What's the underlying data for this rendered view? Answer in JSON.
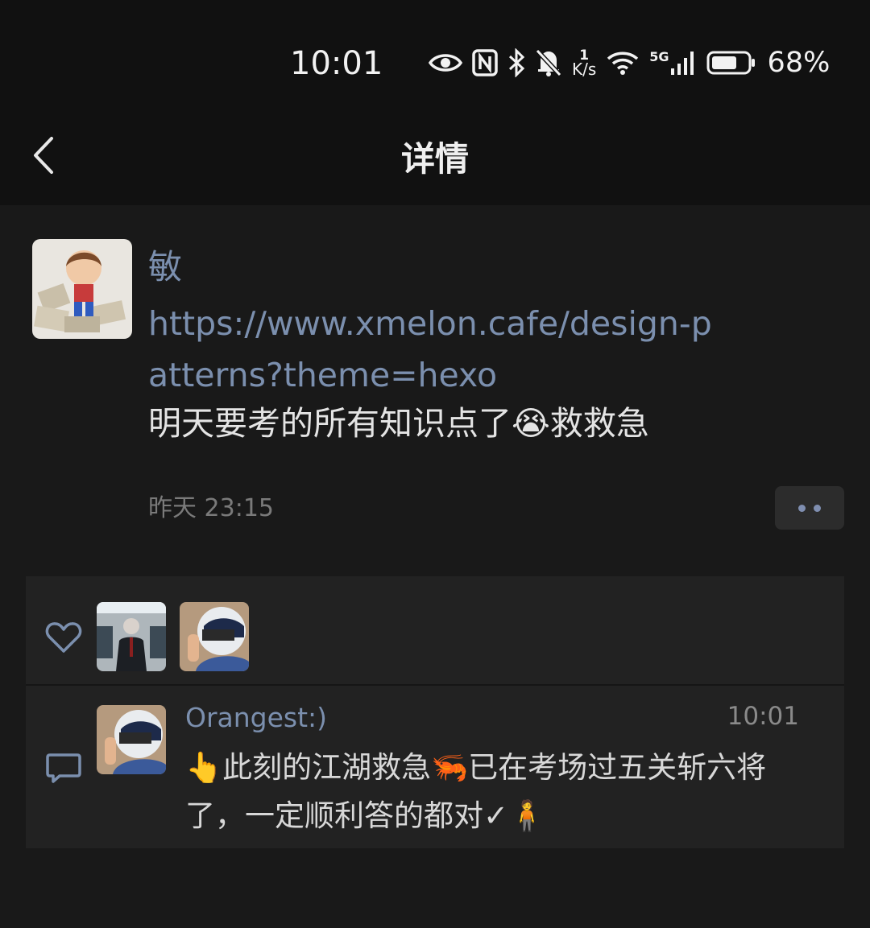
{
  "status_bar": {
    "time": "10:01",
    "speed_value": "1",
    "speed_unit": "K/s",
    "network": "5G",
    "battery_percent": "68%",
    "icons": [
      "eye-icon",
      "nfc-icon",
      "bluetooth-icon",
      "mute-bell-icon",
      "wifi-icon",
      "signal-icon",
      "battery-icon"
    ]
  },
  "header": {
    "title": "详情"
  },
  "post": {
    "author": "敏",
    "link": "https://www.xmelon.cafe/design-patterns?theme=hexo",
    "text_before": "明天要考的所有知识点了",
    "emoji": "😭",
    "text_after": "救救急",
    "time": "昨天 23:15"
  },
  "likes": {
    "users": [
      "liker-1",
      "liker-2"
    ]
  },
  "comments": [
    {
      "name": "Orangest:)",
      "time": "10:01",
      "text": "👆此刻的江湖救急🦐已在考场过五关斩六将了，一定顺利答的都对✓🧍"
    }
  ]
}
